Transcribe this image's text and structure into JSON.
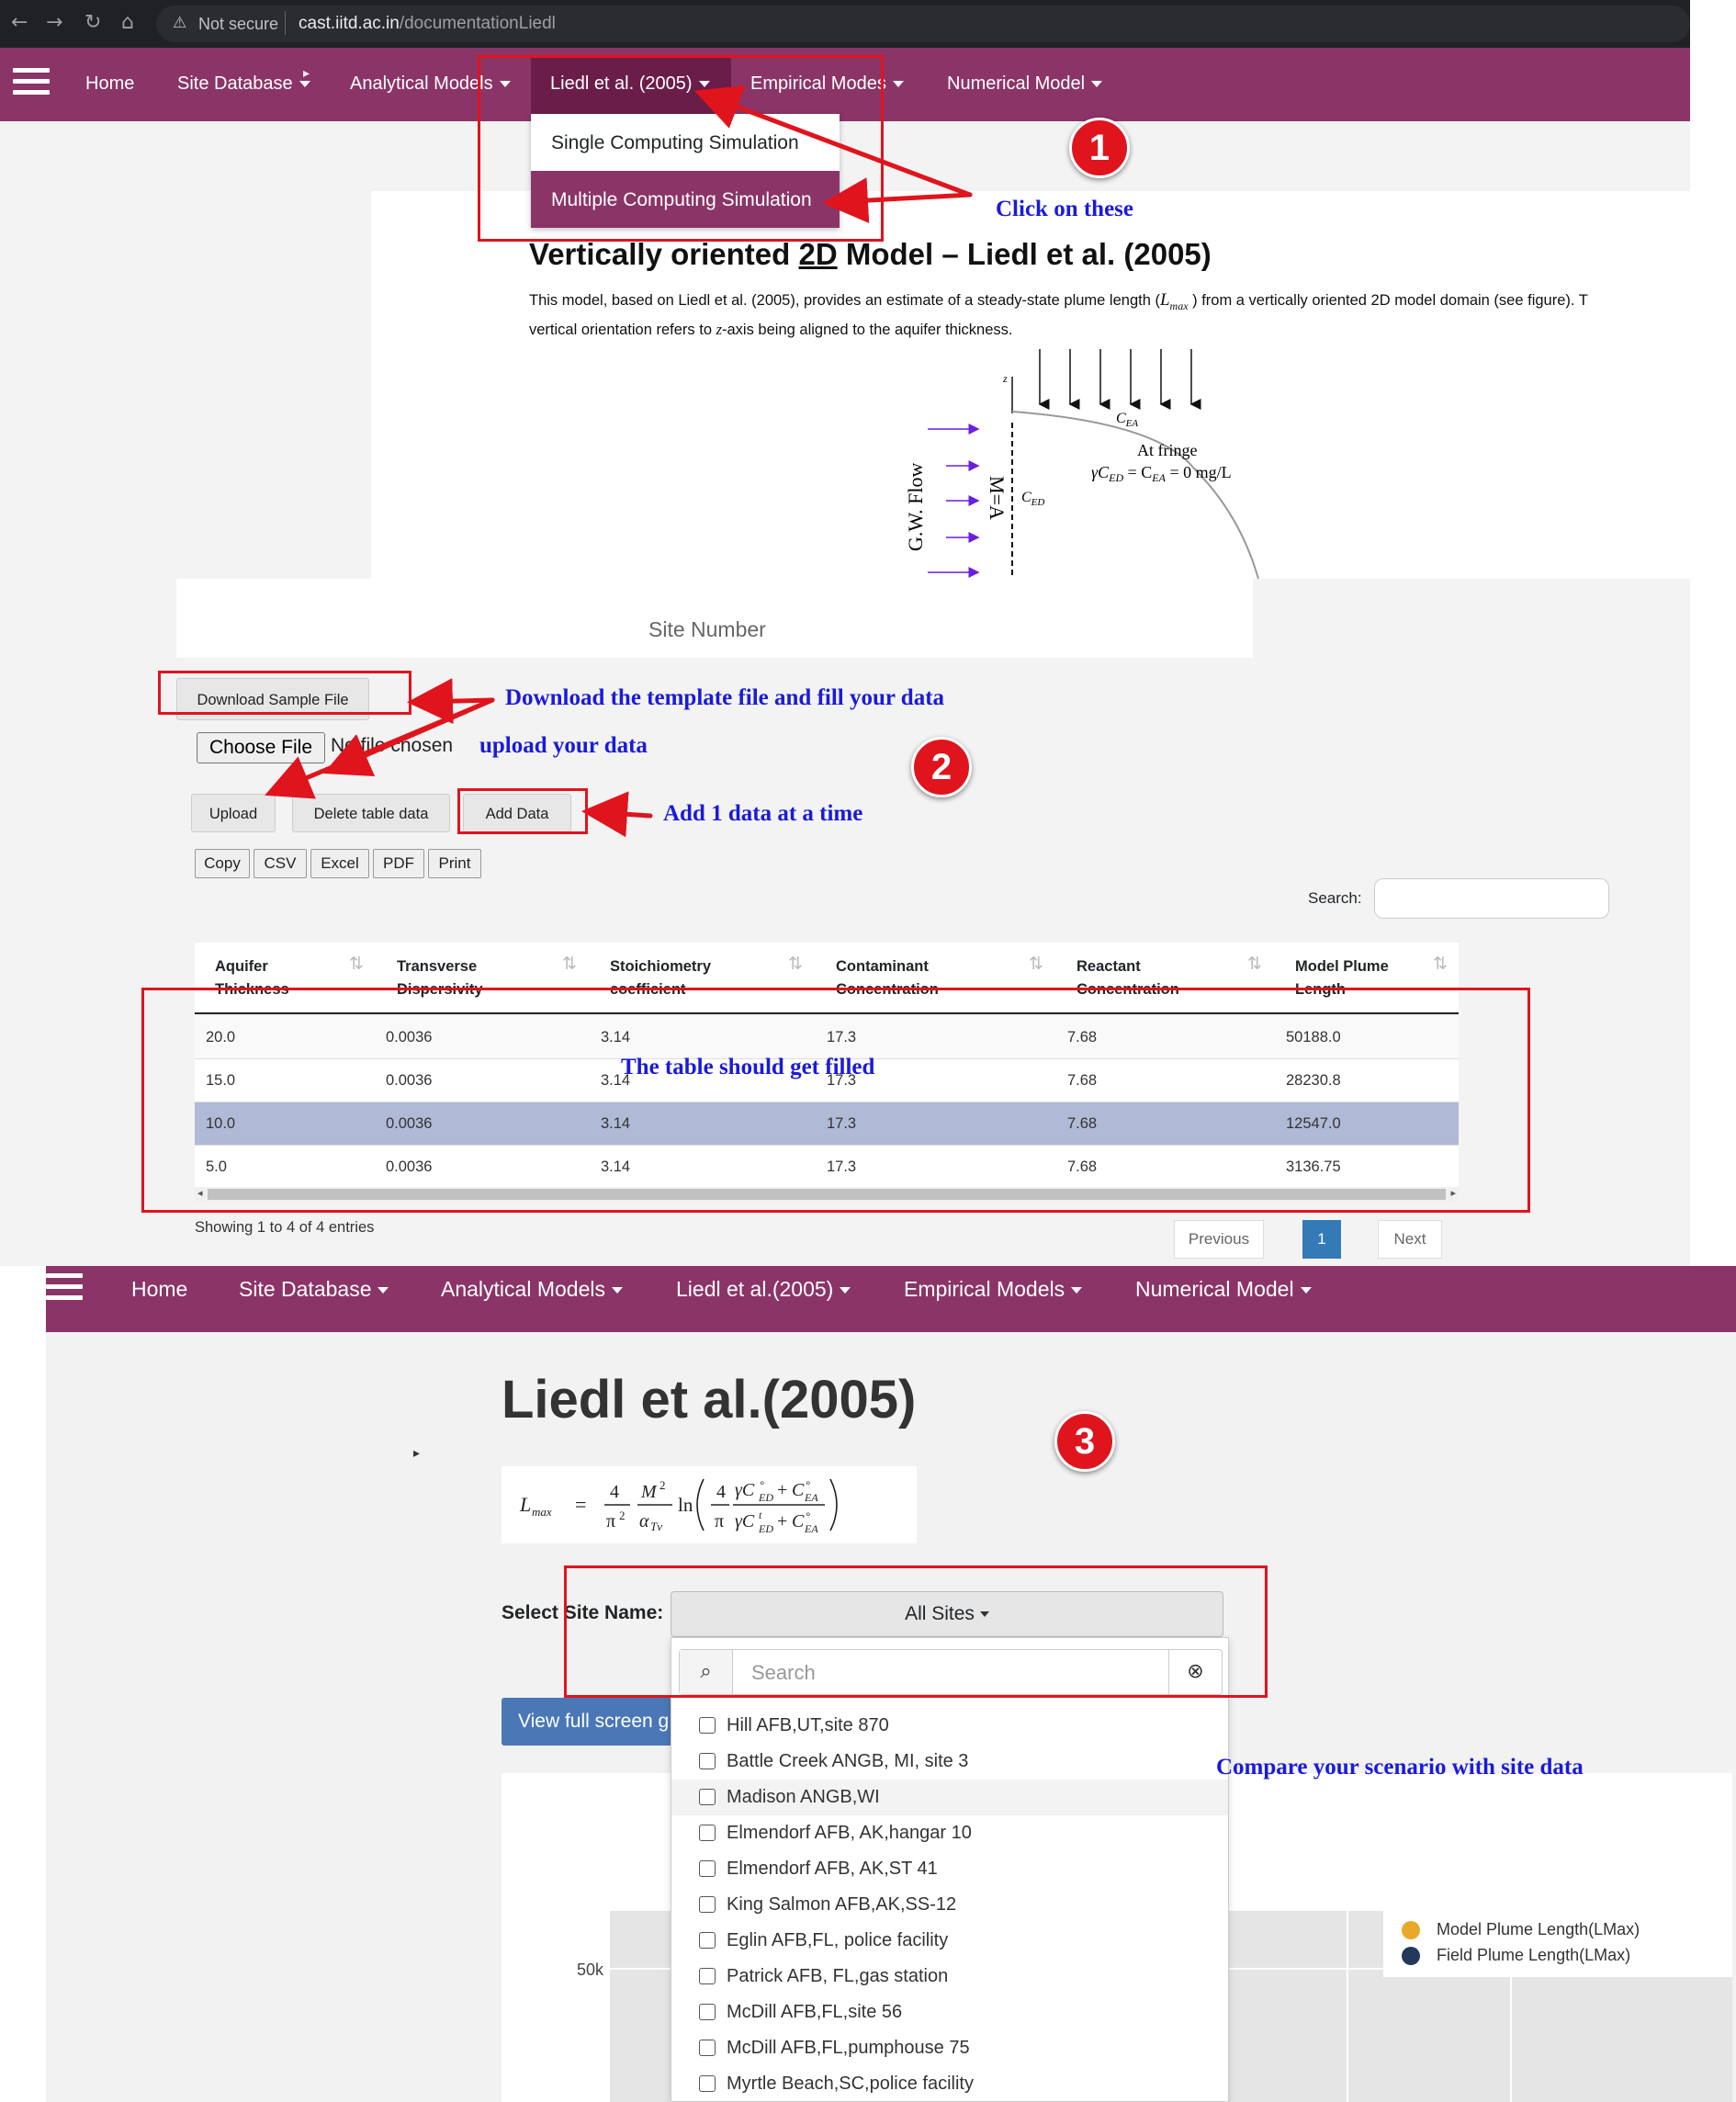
{
  "browser": {
    "warning": "Not secure",
    "url_host": "cast.iitd.ac.in",
    "url_path": "/documentationLiedl"
  },
  "nav_top": {
    "home": "Home",
    "site_database": "Site Database",
    "analytical_models": "Analytical Models",
    "liedl": "Liedl et al. (2005)",
    "empirical_models": "Empirical Modes",
    "numerical_model": "Numerical Model"
  },
  "liedl_menu": [
    "Single Computing Simulation",
    "Multiple Computing Simulation"
  ],
  "model": {
    "title_pre": "Vertically oriented ",
    "title_2d": "2D",
    "title_post": " Model – Liedl et al. (2005)",
    "desc_1": "This model, based on Liedl et al. (2005), provides an estimate of a steady-state plume length (",
    "desc_lmax": "L",
    "desc_lmax_sub": "max",
    "desc_2": " ) from a vertically oriented 2D model domain (see figure). T",
    "desc_3": "vertical orientation refers to ",
    "desc_z": "z",
    "desc_4": "-axis being aligned to the aquifer thickness.",
    "figure": {
      "z_label": "z",
      "cea": "C",
      "cea_sub": "EA",
      "at_fringe": "At fringe",
      "eq_gamma": "γC",
      "eq_ced_sub": "ED",
      "eq_eq": " = C",
      "eq_cea_sub": "EA",
      "eq_rhs": " = 0 mg/L",
      "ced": "C",
      "ced_sub": "ED",
      "flow": "G.W. Flow",
      "m_label": "M=A"
    }
  },
  "callouts": {
    "click_on_these": "Click on these",
    "download_template": "Download the template file and fill your data",
    "upload_your_data": "upload your data",
    "add_one": "Add 1 data at a time",
    "table_filled": "The table should get filled",
    "compare": "Compare your scenario with site data",
    "badge1": "1",
    "badge2": "2",
    "badge3": "3"
  },
  "section2": {
    "site_number": "Site Number",
    "download_sample": "Download Sample File",
    "choose_file": "Choose File",
    "no_file": "No file chosen",
    "upload": "Upload",
    "delete_table": "Delete table data",
    "add_data": "Add Data",
    "exports": [
      "Copy",
      "CSV",
      "Excel",
      "PDF",
      "Print"
    ],
    "search_label": "Search:",
    "showing": "Showing 1 to 4 of 4 entries",
    "previous": "Previous",
    "page": "1",
    "next": "Next"
  },
  "table": {
    "headers": [
      [
        "Aquifer",
        "Thickness"
      ],
      [
        "Transverse",
        "Dispersivity"
      ],
      [
        "Stoichiometry",
        "coefficient"
      ],
      [
        "Contaminant",
        "Concentration"
      ],
      [
        "Reactant",
        "Concentration"
      ],
      [
        "Model Plume",
        "Length"
      ]
    ],
    "rows": [
      [
        "20.0",
        "0.0036",
        "3.14",
        "17.3",
        "7.68",
        "50188.0"
      ],
      [
        "15.0",
        "0.0036",
        "3.14",
        "17.3",
        "7.68",
        "28230.8"
      ],
      [
        "10.0",
        "0.0036",
        "3.14",
        "17.3",
        "7.68",
        "12547.0"
      ],
      [
        "5.0",
        "0.0036",
        "3.14",
        "17.3",
        "7.68",
        "3136.75"
      ]
    ]
  },
  "nav_bottom": {
    "home": "Home",
    "site_database": "Site Database",
    "analytical_models": "Analytical Models",
    "liedl": "Liedl et al.(2005)",
    "empirical_models": "Empirical Models",
    "numerical_model": "Numerical Model"
  },
  "section3": {
    "title": "Liedl et al.(2005)",
    "select_label": "Select Site Name:",
    "select_value": "All Sites",
    "search_placeholder": "Search",
    "full_screen": "View full screen g",
    "tick_50k": "50k",
    "legend": [
      "Model Plume Length(LMax)",
      "Field Plume Length(LMax)"
    ],
    "legend_colors": [
      "#e8a92b",
      "#22395b"
    ],
    "sites": [
      "Hill AFB,UT,site 870",
      "Battle Creek ANGB, MI, site 3",
      "Madison ANGB,WI",
      "Elmendorf AFB, AK,hangar 10",
      "Elmendorf AFB, AK,ST 41",
      "King Salmon AFB,AK,SS-12",
      "Eglin AFB,FL, police facility",
      "Patrick AFB, FL,gas station",
      "McDill AFB,FL,site 56",
      "McDill AFB,FL,pumphouse 75",
      "Myrtle Beach,SC,police facility"
    ]
  },
  "colors": {
    "navbar": "#8b3467",
    "annotation_red": "#e0141d",
    "annotation_blue": "#1a1adc"
  }
}
